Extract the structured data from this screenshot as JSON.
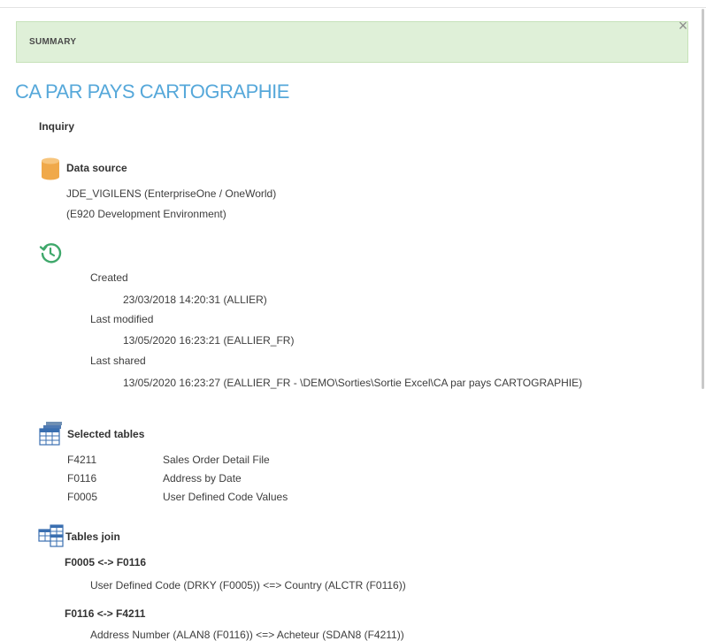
{
  "dialog": {
    "close_glyph": "×",
    "banner_label": "SUMMARY",
    "title": "CA PAR PAYS CARTOGRAPHIE",
    "type": "Inquiry",
    "accent_color": "#56a8da",
    "banner_color": "#dff0d8"
  },
  "data_source": {
    "heading": "Data source",
    "icon": "database-icon",
    "line1": "JDE_VIGILENS (EnterpriseOne / OneWorld)",
    "line2": "(E920 Development Environment)"
  },
  "history": {
    "icon": "history-icon",
    "created_label": "Created",
    "created_value": "23/03/2018 14:20:31 (ALLIER)",
    "modified_label": "Last modified",
    "modified_value": "13/05/2020 16:23:21 (EALLIER_FR)",
    "shared_label": "Last shared",
    "shared_value": "13/05/2020 16:23:27 (EALLIER_FR - \\DEMO\\Sorties\\Sortie Excel\\CA par pays CARTOGRAPHIE)"
  },
  "selected_tables": {
    "heading": "Selected tables",
    "icon": "table-icon",
    "rows": [
      {
        "code": "F4211",
        "description": "Sales Order Detail File"
      },
      {
        "code": "F0116",
        "description": "Address by Date"
      },
      {
        "code": "F0005",
        "description": "User Defined Code Values"
      }
    ]
  },
  "tables_join": {
    "heading": "Tables join",
    "icon": "join-icon",
    "joins": [
      {
        "title": "F0005 <-> F0116",
        "detail": "User Defined Code (DRKY (F0005)) <=> Country (ALCTR (F0116))"
      },
      {
        "title": "F0116 <-> F4211",
        "detail": "Address Number (ALAN8 (F0116)) <=> Acheteur (SDAN8 (F4211))"
      }
    ]
  }
}
